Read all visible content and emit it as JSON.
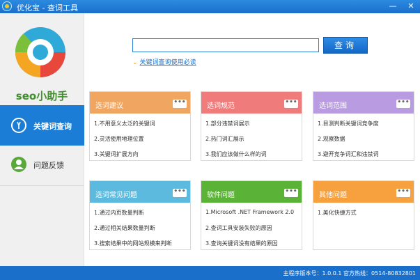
{
  "window": {
    "title": "优化宝 - 查词工具",
    "minimize": "—",
    "close": "✕"
  },
  "sidebar": {
    "logo_text": "seo小助手",
    "items": [
      {
        "label": "关键词查询",
        "icon": "magnifier-icon",
        "active": true
      },
      {
        "label": "问题反馈",
        "icon": "user-icon",
        "active": false
      }
    ]
  },
  "search": {
    "value": "",
    "button": "查询",
    "help_link": "关键词查询使用必读"
  },
  "cards": [
    {
      "title": "选词建议",
      "color": "#f0a560",
      "items": [
        "1.不用意义太泛的关键词",
        "2.灵活使用地理位置",
        "3.关键词扩展方向"
      ]
    },
    {
      "title": "选词规范",
      "color": "#ef7b7b",
      "items": [
        "1.部分违禁词展示",
        "2.热门词汇展示",
        "3.我们应该做什么样的词"
      ]
    },
    {
      "title": "选词范围",
      "color": "#b89be0",
      "items": [
        "1.目测判断关键词竞争度",
        "2.观察数据",
        "3.避开竞争词汇和违禁词"
      ]
    },
    {
      "title": "选词常见问题",
      "color": "#5bbadd",
      "items": [
        "1.通过内页数量判断",
        "2.通过相关结果数量判断",
        "3.搜索结果中的网站规模来判断"
      ]
    },
    {
      "title": "软件问题",
      "color": "#5ab337",
      "items": [
        "1.Microsoft .NET Framework 2.0",
        "2.查词工具安装失败的原因",
        "3.查询关键词没有结果的原因"
      ]
    },
    {
      "title": "其他问题",
      "color": "#f7a13e",
      "items": [
        "1.美化快捷方式"
      ]
    }
  ],
  "status": {
    "text": "主程序版本号：1.0.0.1  官方热线：0514-80832801"
  }
}
